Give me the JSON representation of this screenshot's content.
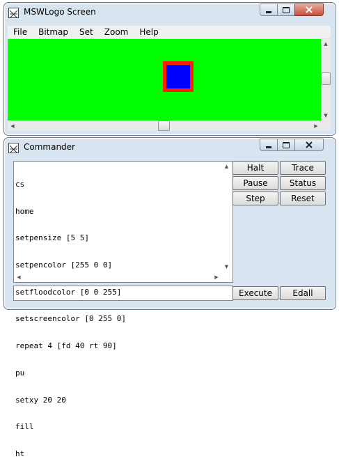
{
  "screen_window": {
    "title": "MSWLogo Screen",
    "menu": [
      "File",
      "Bitmap",
      "Set",
      "Zoom",
      "Help"
    ],
    "canvas_color": "#00ff00",
    "square_fill": "#0000ff",
    "square_pen": "#ff0000"
  },
  "commander_window": {
    "title": "Commander",
    "history": [
      "cs",
      "home",
      "setpensize [5 5]",
      "setpencolor [255 0 0]",
      "setfloodcolor [0 0 255]",
      "setscreencolor [0 255 0]",
      "repeat 4 [fd 40 rt 90]",
      "pu",
      "setxy 20 20",
      "fill",
      "ht"
    ],
    "input_value": "",
    "buttons": {
      "halt": "Halt",
      "trace": "Trace",
      "pause": "Pause",
      "status": "Status",
      "step": "Step",
      "reset": "Reset",
      "execute": "Execute",
      "edall": "Edall"
    }
  }
}
